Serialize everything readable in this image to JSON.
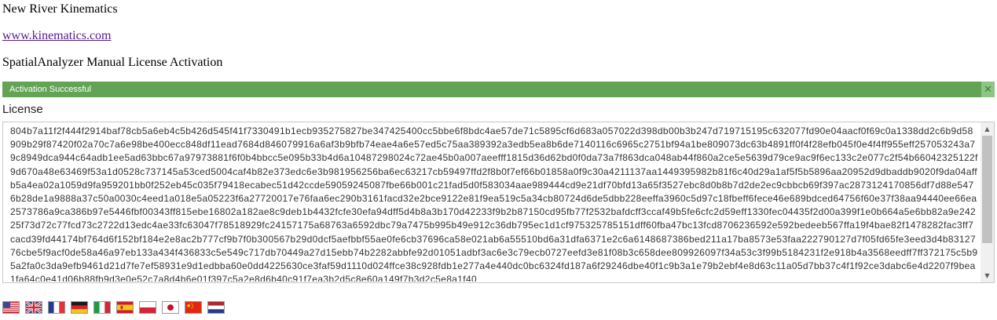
{
  "header": {
    "company": "New River Kinematics",
    "website": "www.kinematics.com",
    "product_title": "SpatialAnalyzer Manual License Activation"
  },
  "banner": {
    "message": "Activation Successful",
    "close_glyph": "✕",
    "color": "#62a356"
  },
  "license": {
    "label": "License",
    "text": "804b7a11f2f444f2914baf78cb5a6eb4c5b426d545f41f7330491b1ecb935275827be347425400cc5bbe6f8bdc4ae57de71c5895cf6d683a057022d398db00b3b247d719715195c632077fd90e04aacf0f69c0a1338dd2c6b9d58909b29f87420f02a70c7a6e98be400ecc848df11ead7684d846079916a6af3b9bfb74eae4a6e57ed5c75aa389392a3edb5ea8b6de7140116c6965c2751bf94a1be809073dc63b4891ff0f4f28efb045f0e4f4ff955eff257053243a79c8949dca944c64adb1ee5ad63bbc67a97973881f6f0b4bbcc5e095b33b4d6a10487298024c72ae45b0a007aeefff1815d36d62bd0f0da73a7f863dca048ab44f860a2ce5e5639d79ce9ac9f6ec133c2e077c2f54b66042325122f9d670a48e63469f53a1d0528c737145a53ced5004caf4b82e373edc6e3b981956256ba6ec63217cb59497ffd2f8b0f7ef66b01858a0f9c30a4211137aa1449395982b81f6c40d29a1af5f5b5896aa20952d9dbaddb9020f9da04affb5a4ea02a1059d9fa959201bb0f252eb45c035f79418ecabec51d42ccde59059245087fbe66b001c21fad5d0f583034aae989444cd9e21df70bfd13a65f3527ebc8d0b8b7d2de2ec9cbbcb69f397ac2873124170856df7d88e5476b28de1a9888a37c50a0030c4eed1a018e5a05223f6a27720017e76faa6ec290b3161facd32e2bce9122e81f9ea519c5a34cb80724d6de5dbb228eeffa3960c5d97c18fbeff6fece46e689bdced64756f60e37f38aa94440ee66ea2573786a9ca386b97e5446fbf00343ff815ebe16802a182ae8c9deb1b4432fcfe30efa94dff5d4b8a3b170d42233f9b2b87150cd95fb77f2532bafdcff3ccaf49b5fe6cfc2d59eff1330fec04435f2d00a399f1e0b664a5e6bb82a9e24225f73d72c77fcd73c2722d13edc4ae33fc63047f78518929fc24157175a68763a6592dbc79a7475b995b49e912c36db795ec1d1cf975325785151dff60fba47bc13fcd8706236592e592bedeeb567ffa19f4bae82f1478282fac3ff7cacd39fd44174bf764d6f152bf184e2e8ac2b777cf9b7f0b300567b29d0dcf5aefbbf55ae0fe6cb37696ca58e021ab6a55510bd6a31dfa6371e2c6a6148687386bed211a17ba8573e53faa222790127d7f05fd65fe3eed3d4b8312776cbe5f9acf0de58a46a97eb133a434f436833c5e549c717db70449a27d15ebb74b2282abbfe92d01051adbf3ac6e3c79ecb0727eefd3e81f08b3c658dee809926097f34a53c3f99b5184231f2e918b4a3568eedff7ff372175c5b95a2fa0c3da9efb9461d21d7fe7ef58931e9d1edbba60e0dd4225630ce3faf59d1110d024ffce38c928fdb1e277a4e440dc0bc6324fd187a6f29246dbe40f1c9b3a1e79b2ebf4e8d63c11a05d7bb37c4f1f92ce3dabc6e4d2207f9bea1fa64c0e41d06b88fb9d3e0e52c7a8d4b6e01f397c5a2e8d6b40c91f7ea3b2d5c8e60a149f7b3d2c5e8a1f40"
  },
  "scrollbar": {
    "up_glyph": "▲",
    "down_glyph": "▼"
  },
  "languages": [
    {
      "name": "flag-us-icon"
    },
    {
      "name": "flag-uk-icon"
    },
    {
      "name": "flag-france-icon"
    },
    {
      "name": "flag-germany-icon"
    },
    {
      "name": "flag-italy-icon"
    },
    {
      "name": "flag-spain-icon"
    },
    {
      "name": "flag-poland-icon"
    },
    {
      "name": "flag-japan-icon"
    },
    {
      "name": "flag-china-icon"
    },
    {
      "name": "flag-netherlands-icon"
    }
  ]
}
